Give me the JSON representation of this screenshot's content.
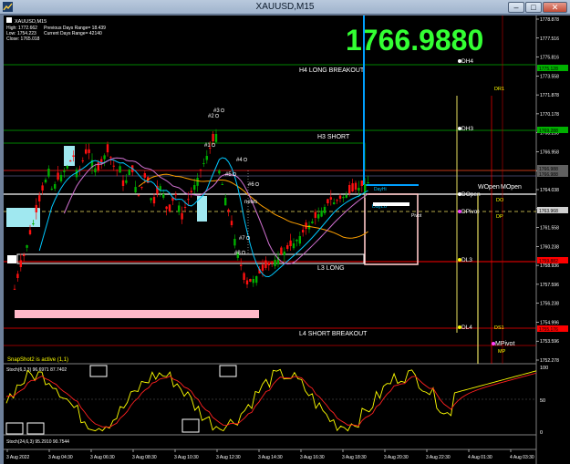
{
  "window": {
    "title": "XAUUSD,M15",
    "buttons": {
      "minimize": "–",
      "maximize": "□",
      "close": "✕"
    }
  },
  "symbol_header": "XAUUSD,M15",
  "stats": [
    {
      "left": "High: 1772.662",
      "right": "Previous Days Range= 18.439"
    },
    {
      "left": "Low: 1754.223",
      "right": "Current Days Range= 42140"
    },
    {
      "left": "Close: 1765.018",
      "right": ""
    }
  ],
  "big_price": "1766.9880",
  "colors": {
    "background": "#000000",
    "bull_candle": "#00b000",
    "bear_candle": "#ff0000",
    "big_price": "#00ff00",
    "pivot_line": "#ffffff",
    "dh_line": "#e8e060",
    "ma_blue": "#00c8ff",
    "ma_orange": "#ffa000",
    "ma_magenta": "#d070d0",
    "stoch_main": "#ffff00",
    "stoch_signal": "#ff0000"
  },
  "price_axis": {
    "ticks": [
      "1778.878",
      "1777.516",
      "1775.816",
      "1773.558",
      "1771.878",
      "1770.178",
      "1768.230",
      "1766.958",
      "1765.558",
      "1764.038",
      "1762.936",
      "1761.558",
      "1760.238",
      "1758.936",
      "1757.596",
      "1756.238",
      "1754.996",
      "1753.596",
      "1752.278"
    ],
    "badges": [
      {
        "label": "1775.128",
        "color": "#00b000"
      },
      {
        "label": "1769.288",
        "color": "#00b000"
      },
      {
        "label": "1766.988",
        "color": "#606060"
      },
      {
        "label": "1766.988",
        "color": "#606060"
      },
      {
        "label": "1763.968",
        "color": "#d0d0d0"
      },
      {
        "label": "1759.882",
        "color": "#ff0000"
      },
      {
        "label": "1755.176",
        "color": "#ff0000"
      }
    ]
  },
  "levels": {
    "h4": "H4 LONG BREAKOUT",
    "h3": "H3 SHORT",
    "l3": "L3 LONG",
    "l4": "L4 SHORT BREAKOUT",
    "dh4": "DH4",
    "dh3": "DH3",
    "dl3": "DL3",
    "dl4": "DL4",
    "dr1": "DR1",
    "ds1": "DS1",
    "dopen": "DOpen",
    "dpivot": "DPivot",
    "do_label": "DO",
    "dp_label": "DP",
    "wopen": "WOpen",
    "mopen": "MOpen",
    "mpivot": "MPivot",
    "mp_label": "MP",
    "dayhi": "DayHi",
    "daylo": "DayLo",
    "pivot": "Pivot",
    "news": "news"
  },
  "markers": [
    "#3",
    "#2",
    "#1",
    "#4",
    "#5",
    "#6",
    "#7",
    "#8"
  ],
  "snapshot_text": "SnapShot2 is active (1,1)",
  "stoch1": {
    "label": "Stoch(6,3,3) 96.6971 87.7402",
    "levels": [
      "100",
      "50",
      "0"
    ]
  },
  "stoch2": {
    "label": "Stoch(24,6,3) 95.2910 90.7544"
  },
  "time_axis": [
    "3 Aug 2022",
    "3 Aug 04:30",
    "3 Aug 06:30",
    "3 Aug 08:30",
    "3 Aug 10:30",
    "3 Aug 12:30",
    "3 Aug 14:30",
    "3 Aug 16:30",
    "3 Aug 18:30",
    "3 Aug 20:30",
    "3 Aug 22:30",
    "4 Aug 01:30",
    "4 Aug 03:30"
  ]
}
